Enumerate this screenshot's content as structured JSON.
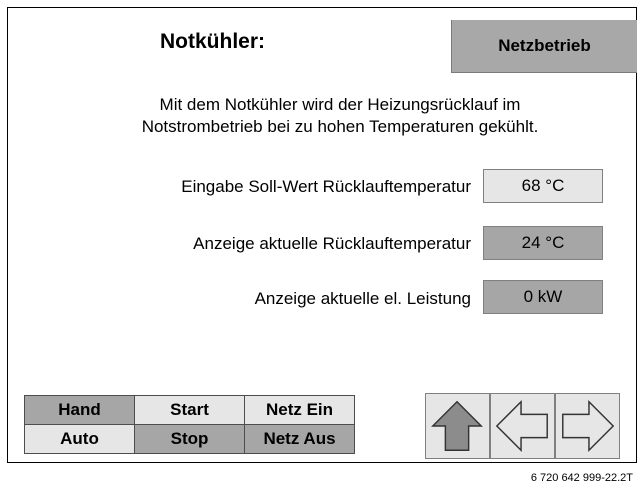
{
  "header": {
    "title": "Notkühler:",
    "mode_button": "Netzbetrieb"
  },
  "description": {
    "line1": "Mit dem Notkühler wird der Heizungsrücklauf im",
    "line2": "Notstrombetrieb bei zu hohen Temperaturen gekühlt."
  },
  "rows": [
    {
      "label": "Eingabe Soll-Wert Rücklauftemperatur",
      "value": "68 °C"
    },
    {
      "label": "Anzeige aktuelle Rücklauftemperatur",
      "value": "24 °C"
    },
    {
      "label": "Anzeige aktuelle el. Leistung",
      "value": "0 kW"
    }
  ],
  "controls": {
    "hand": "Hand",
    "auto": "Auto",
    "start": "Start",
    "stop": "Stop",
    "netz_ein": "Netz Ein",
    "netz_aus": "Netz Aus"
  },
  "arrows": {
    "up": "up-arrow-icon",
    "left": "left-arrow-icon",
    "right": "right-arrow-icon"
  },
  "footer": {
    "figure_id": "6 720 642 999-22.2T"
  },
  "colors": {
    "dark_button": "#a6a6a6",
    "light_button": "#e6e6e6",
    "mode_button": "#a8a8a8",
    "arrow_fill": "#8c8c8c"
  }
}
